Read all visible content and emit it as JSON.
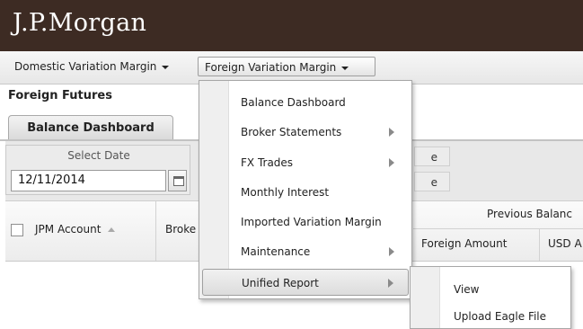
{
  "brand": {
    "name": "J.P.Morgan"
  },
  "menubar": {
    "items": [
      {
        "label": "Domestic Variation Margin"
      },
      {
        "label": "Foreign Variation Margin"
      }
    ]
  },
  "section": {
    "title": "Foreign Futures"
  },
  "tabs": [
    {
      "label": "Balance Dashboard"
    }
  ],
  "filter": {
    "date_label": "Select Date",
    "date_value": "12/11/2014",
    "partial_buttons": [
      "e",
      "e"
    ]
  },
  "grid": {
    "columns": [
      "JPM Account",
      "Broke"
    ],
    "group_header": "Previous Balanc",
    "sub_columns": [
      "Foreign Amount",
      "USD A"
    ]
  },
  "dropdown": {
    "items": [
      {
        "label": "Balance Dashboard",
        "submenu": false
      },
      {
        "label": "Broker Statements",
        "submenu": true
      },
      {
        "label": "FX Trades",
        "submenu": true
      },
      {
        "label": "Monthly Interest",
        "submenu": false
      },
      {
        "label": "Imported Variation Margin",
        "submenu": false
      },
      {
        "label": "Maintenance",
        "submenu": true
      },
      {
        "label": "Unified Report",
        "submenu": true,
        "active": true
      }
    ]
  },
  "submenu": {
    "items": [
      {
        "label": "View"
      },
      {
        "label": "Upload Eagle File"
      }
    ]
  },
  "colors": {
    "brand_bar": "#3d2b23",
    "menu_gray": "#e7e7e7"
  }
}
